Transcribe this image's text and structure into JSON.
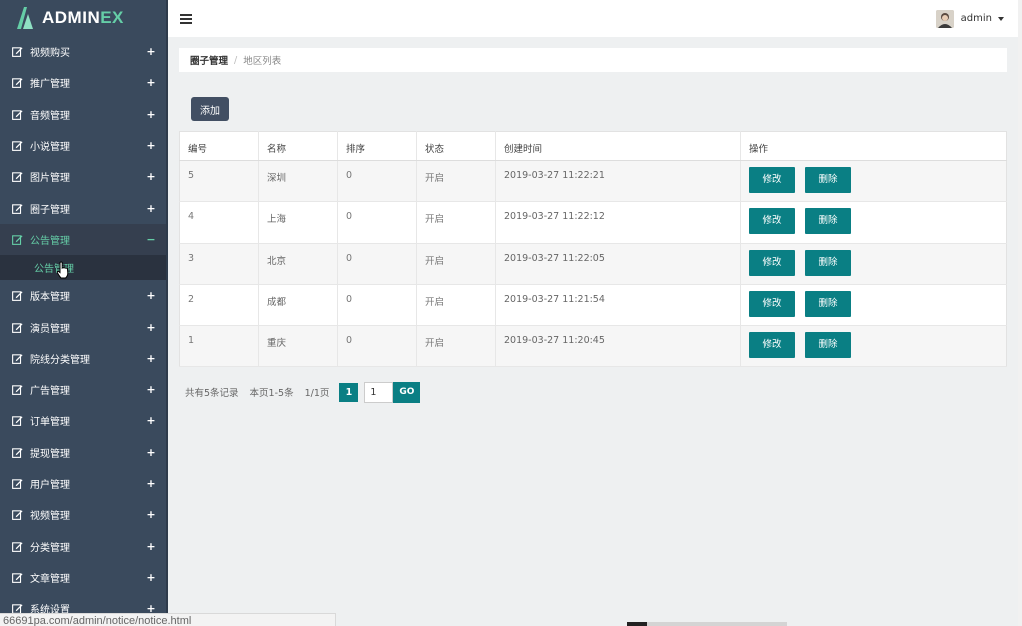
{
  "logo": {
    "text_main": "ADMIN",
    "text_accent": "EX"
  },
  "sidebar": {
    "items": [
      {
        "label": "视频购买",
        "toggle": "+"
      },
      {
        "label": "推广管理",
        "toggle": "+"
      },
      {
        "label": "音频管理",
        "toggle": "+"
      },
      {
        "label": "小说管理",
        "toggle": "+"
      },
      {
        "label": "图片管理",
        "toggle": "+"
      },
      {
        "label": "圈子管理",
        "toggle": "+"
      },
      {
        "label": "公告管理",
        "toggle": "−",
        "active": true,
        "children": [
          {
            "label": "公告管理"
          }
        ]
      },
      {
        "label": "版本管理",
        "toggle": "+"
      },
      {
        "label": "演员管理",
        "toggle": "+"
      },
      {
        "label": "院线分类管理",
        "toggle": "+"
      },
      {
        "label": "广告管理",
        "toggle": "+"
      },
      {
        "label": "订单管理",
        "toggle": "+"
      },
      {
        "label": "提现管理",
        "toggle": "+"
      },
      {
        "label": "用户管理",
        "toggle": "+"
      },
      {
        "label": "视频管理",
        "toggle": "+"
      },
      {
        "label": "分类管理",
        "toggle": "+"
      },
      {
        "label": "文章管理",
        "toggle": "+"
      },
      {
        "label": "系统设置",
        "toggle": "+"
      }
    ]
  },
  "header": {
    "user_name": "admin"
  },
  "breadcrumb": {
    "parent": "圈子管理",
    "separator": "/",
    "current": "地区列表"
  },
  "toolbar": {
    "add_label": "添加"
  },
  "table": {
    "headers": [
      "编号",
      "名称",
      "排序",
      "状态",
      "创建时间",
      "操作"
    ],
    "rows": [
      {
        "id": "5",
        "name": "深圳",
        "sort": "0",
        "status": "开启",
        "created": "2019-03-27 11:22:21"
      },
      {
        "id": "4",
        "name": "上海",
        "sort": "0",
        "status": "开启",
        "created": "2019-03-27 11:22:12"
      },
      {
        "id": "3",
        "name": "北京",
        "sort": "0",
        "status": "开启",
        "created": "2019-03-27 11:22:05"
      },
      {
        "id": "2",
        "name": "成都",
        "sort": "0",
        "status": "开启",
        "created": "2019-03-27 11:21:54"
      },
      {
        "id": "1",
        "name": "重庆",
        "sort": "0",
        "status": "开启",
        "created": "2019-03-27 11:20:45"
      }
    ],
    "edit_label": "修改",
    "delete_label": "删除"
  },
  "pagination": {
    "total_text": "共有5条记录",
    "range_text": "本页1-5条",
    "page_text": "1/1页",
    "current_page": "1",
    "jump_value": "1",
    "go_label": "GO"
  },
  "status_bar": {
    "url": "66691pa.com/admin/notice/notice.html"
  },
  "colors": {
    "sidebar_bg": "#3a4a5d",
    "accent_green": "#65cea7",
    "button_teal": "#0a7f84",
    "add_button": "#424f63"
  }
}
